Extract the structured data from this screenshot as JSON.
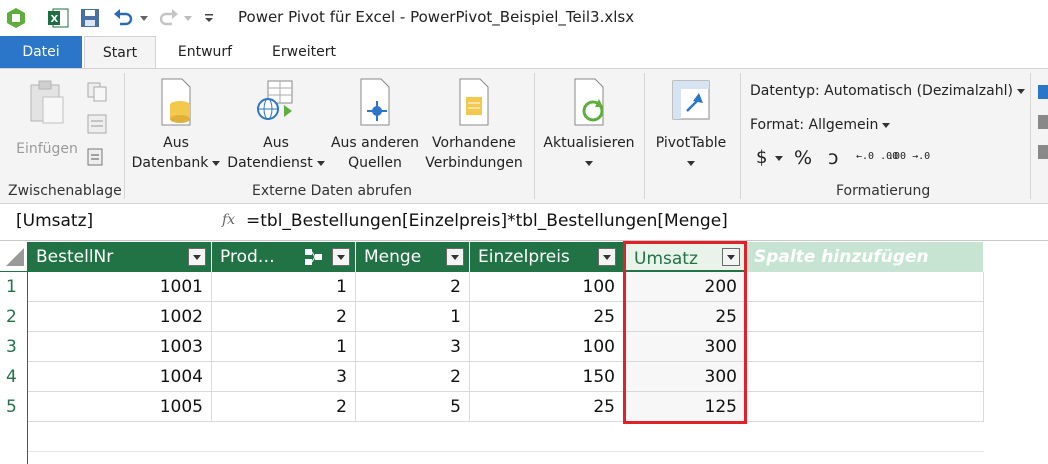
{
  "window": {
    "title": "Power Pivot für Excel - PowerPivot_Beispiel_Teil3.xlsx"
  },
  "tabs": [
    {
      "label": "Datei"
    },
    {
      "label": "Start"
    },
    {
      "label": "Entwurf"
    },
    {
      "label": "Erweitert"
    }
  ],
  "ribbon": {
    "clipboard": {
      "paste": "Einfügen",
      "group": "Zwischenablage"
    },
    "external": {
      "from_db_1": "Aus",
      "from_db_2": "Datenbank",
      "from_service_1": "Aus",
      "from_service_2": "Datendienst",
      "from_other_1": "Aus anderen",
      "from_other_2": "Quellen",
      "existing_1": "Vorhandene",
      "existing_2": "Verbindungen",
      "group": "Externe Daten abrufen"
    },
    "refresh": {
      "label": "Aktualisieren"
    },
    "pivot": {
      "label": "PivotTable"
    },
    "formatting": {
      "datatype": "Datentyp: Automatisch (Dezimalzahl)",
      "format": "Format: Allgemein",
      "currency": "$",
      "percent": "%",
      "comma": "ɔ",
      "inc_decimal": "←.0 .00",
      "dec_decimal": ".00 →.0",
      "group": "Formatierung"
    }
  },
  "formula_bar": {
    "name": "[Umsatz]",
    "fx": "fx",
    "formula": "=tbl_Bestellungen[Einzelpreis]*tbl_Bestellungen[Menge]"
  },
  "table": {
    "columns": [
      "BestellNr",
      "Prod…",
      "Menge",
      "Einzelpreis",
      "Umsatz",
      "Spalte hinzufügen"
    ],
    "rows": [
      {
        "num": "1",
        "cells": [
          "1001",
          "1",
          "2",
          "100",
          "200"
        ]
      },
      {
        "num": "2",
        "cells": [
          "1002",
          "2",
          "1",
          "25",
          "25"
        ]
      },
      {
        "num": "3",
        "cells": [
          "1003",
          "1",
          "3",
          "100",
          "300"
        ]
      },
      {
        "num": "4",
        "cells": [
          "1004",
          "3",
          "2",
          "150",
          "300"
        ]
      },
      {
        "num": "5",
        "cells": [
          "1005",
          "2",
          "5",
          "25",
          "125"
        ]
      }
    ]
  },
  "colors": {
    "header_green": "#217346",
    "file_tab_blue": "#2b76c8",
    "highlight_red": "#e0212a"
  }
}
